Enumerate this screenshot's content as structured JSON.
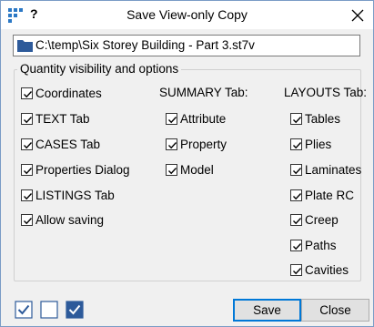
{
  "window": {
    "title": "Save View-only Copy",
    "help_label": "?",
    "icon": "grid-app-icon",
    "close_icon": "close-icon"
  },
  "path": {
    "icon": "folder-icon",
    "value": "C:\\temp\\Six Storey Building - Part 3.st7v"
  },
  "group": {
    "legend": "Quantity visibility and options"
  },
  "left_column": {
    "items": [
      {
        "label": "Coordinates",
        "checked": true
      },
      {
        "label": "TEXT Tab",
        "checked": true
      },
      {
        "label": "CASES Tab",
        "checked": true
      },
      {
        "label": "Properties Dialog",
        "checked": true
      },
      {
        "label": "LISTINGS Tab",
        "checked": true
      },
      {
        "label": "Allow saving",
        "checked": true
      }
    ]
  },
  "summary_column": {
    "heading": "SUMMARY Tab:",
    "items": [
      {
        "label": "Attribute",
        "checked": true
      },
      {
        "label": "Property",
        "checked": true
      },
      {
        "label": "Model",
        "checked": true
      }
    ]
  },
  "layouts_column": {
    "heading": "LAYOUTS Tab:",
    "items": [
      {
        "label": "Tables",
        "checked": true
      },
      {
        "label": "Plies",
        "checked": true
      },
      {
        "label": "Laminates",
        "checked": true
      },
      {
        "label": "Plate RC",
        "checked": true
      },
      {
        "label": "Creep",
        "checked": true
      },
      {
        "label": "Paths",
        "checked": true
      },
      {
        "label": "Cavities",
        "checked": true
      }
    ]
  },
  "footer": {
    "tools": [
      "check-all-icon",
      "uncheck-all-icon",
      "toggle-all-icon"
    ],
    "save_label": "Save",
    "close_label": "Close"
  },
  "colors": {
    "accent": "#2d5a9a",
    "button_default_border": "#0078d7"
  }
}
